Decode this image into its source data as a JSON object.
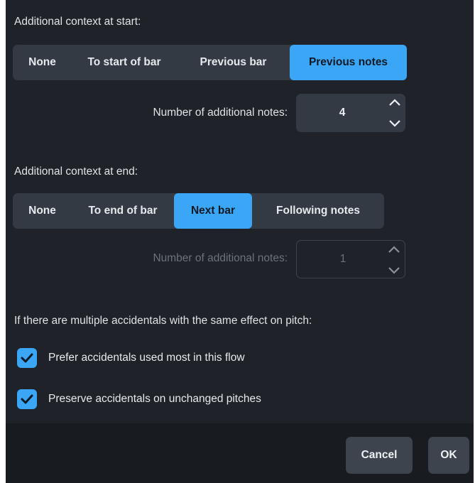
{
  "start": {
    "heading": "Additional context at start:",
    "options": [
      "None",
      "To start of bar",
      "Previous bar",
      "Previous notes"
    ],
    "selected_index": 3,
    "notes_label": "Number of additional notes:",
    "notes_value": "4",
    "notes_enabled": true
  },
  "end": {
    "heading": "Additional context at end:",
    "options": [
      "None",
      "To end of bar",
      "Next bar",
      "Following notes"
    ],
    "selected_index": 2,
    "notes_label": "Number of additional notes:",
    "notes_value": "1",
    "notes_enabled": false
  },
  "accidentals": {
    "heading": "If there are multiple accidentals with the same effect on pitch:",
    "options": [
      {
        "label": "Prefer accidentals used most in this flow",
        "checked": true
      },
      {
        "label": "Preserve accidentals on unchanged pitches",
        "checked": true
      }
    ]
  },
  "footer": {
    "cancel_label": "Cancel",
    "ok_label": "OK"
  },
  "colors": {
    "accent": "#3aa6f5",
    "dialog_bg": "#1f2329",
    "control_bg": "#333a43",
    "disabled_text": "#6b727b"
  },
  "icons": {
    "stepper_up": "chevron-up-icon",
    "stepper_down": "chevron-down-icon",
    "checkbox": "checkmark-icon"
  }
}
